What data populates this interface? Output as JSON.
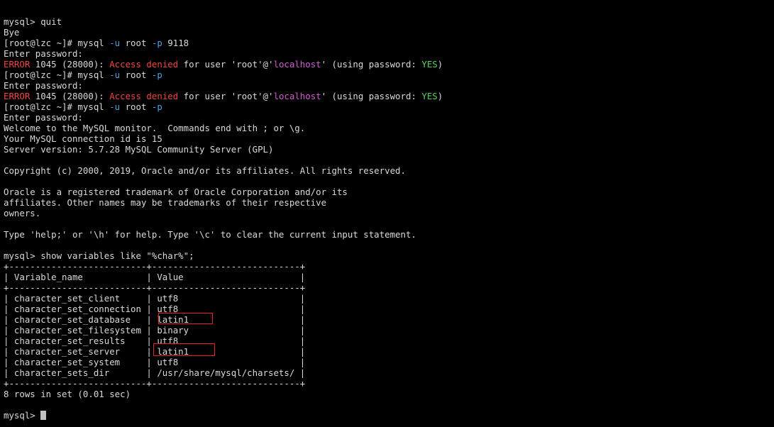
{
  "terminal": {
    "lines": [
      [
        {
          "t": "mysql> quit"
        }
      ],
      [
        {
          "t": "Bye"
        }
      ],
      [
        {
          "t": "[root@lzc ~]# mysql "
        },
        {
          "t": "-u",
          "c": "cyan"
        },
        {
          "t": " root "
        },
        {
          "t": "-p",
          "c": "cyan"
        },
        {
          "t": " 9118"
        }
      ],
      [
        {
          "t": "Enter password:"
        }
      ],
      [
        {
          "t": "ERROR",
          "c": "red"
        },
        {
          "t": " 1045 (28000): "
        },
        {
          "t": "Access denied",
          "c": "red"
        },
        {
          "t": " for user 'root'@'"
        },
        {
          "t": "localhost",
          "c": "magenta"
        },
        {
          "t": "' (using password: "
        },
        {
          "t": "YES",
          "c": "green"
        },
        {
          "t": ")"
        }
      ],
      [
        {
          "t": "[root@lzc ~]# mysql "
        },
        {
          "t": "-u",
          "c": "cyan"
        },
        {
          "t": " root "
        },
        {
          "t": "-p",
          "c": "cyan"
        }
      ],
      [
        {
          "t": "Enter password:"
        }
      ],
      [
        {
          "t": "ERROR",
          "c": "red"
        },
        {
          "t": " 1045 (28000): "
        },
        {
          "t": "Access denied",
          "c": "red"
        },
        {
          "t": " for user 'root'@'"
        },
        {
          "t": "localhost",
          "c": "magenta"
        },
        {
          "t": "' (using password: "
        },
        {
          "t": "YES",
          "c": "green"
        },
        {
          "t": ")"
        }
      ],
      [
        {
          "t": "[root@lzc ~]# mysql "
        },
        {
          "t": "-u",
          "c": "cyan"
        },
        {
          "t": " root "
        },
        {
          "t": "-p",
          "c": "cyan"
        }
      ],
      [
        {
          "t": "Enter password:"
        }
      ],
      [
        {
          "t": "Welcome to the MySQL monitor.  Commands end with ; or \\g."
        }
      ],
      [
        {
          "t": "Your MySQL connection id is 15"
        }
      ],
      [
        {
          "t": "Server version: 5.7.28 MySQL Community Server (GPL)"
        }
      ],
      [],
      [
        {
          "t": "Copyright (c) 2000, 2019, Oracle and/or its affiliates. All rights reserved."
        }
      ],
      [],
      [
        {
          "t": "Oracle is a registered trademark of Oracle Corporation and/or its"
        }
      ],
      [
        {
          "t": "affiliates. Other names may be trademarks of their respective"
        }
      ],
      [
        {
          "t": "owners."
        }
      ],
      [],
      [
        {
          "t": "Type 'help;' or '\\h' for help. Type '\\c' to clear the current input statement."
        }
      ],
      [],
      [
        {
          "t": "mysql> show variables like \"%char%\";"
        }
      ],
      [
        {
          "t": "+--------------------------+----------------------------+"
        }
      ],
      [
        {
          "t": "| Variable_name            | Value                      |"
        }
      ],
      [
        {
          "t": "+--------------------------+----------------------------+"
        }
      ],
      [
        {
          "t": "| character_set_client     | utf8                       |"
        }
      ],
      [
        {
          "t": "| character_set_connection | utf8                       |"
        }
      ],
      [
        {
          "t": "| character_set_database   | latin1                     |"
        }
      ],
      [
        {
          "t": "| character_set_filesystem | binary                     |"
        }
      ],
      [
        {
          "t": "| character_set_results    | utf8                       |"
        }
      ],
      [
        {
          "t": "| character_set_server     | latin1                     |"
        }
      ],
      [
        {
          "t": "| character_set_system     | utf8                       |"
        }
      ],
      [
        {
          "t": "| character_sets_dir       | /usr/share/mysql/charsets/ |"
        }
      ],
      [
        {
          "t": "+--------------------------+----------------------------+"
        }
      ],
      [
        {
          "t": "8 rows in set (0.01 sec)"
        }
      ],
      [],
      [
        {
          "t": "mysql> "
        }
      ]
    ]
  },
  "colors": {
    "background": "#000000",
    "text": "#d9d9d9",
    "cyan": "#4aa3df",
    "red": "#ef4343",
    "magenta": "#d25cd2",
    "green": "#56d45c",
    "highlight_box": "#e0262c"
  }
}
